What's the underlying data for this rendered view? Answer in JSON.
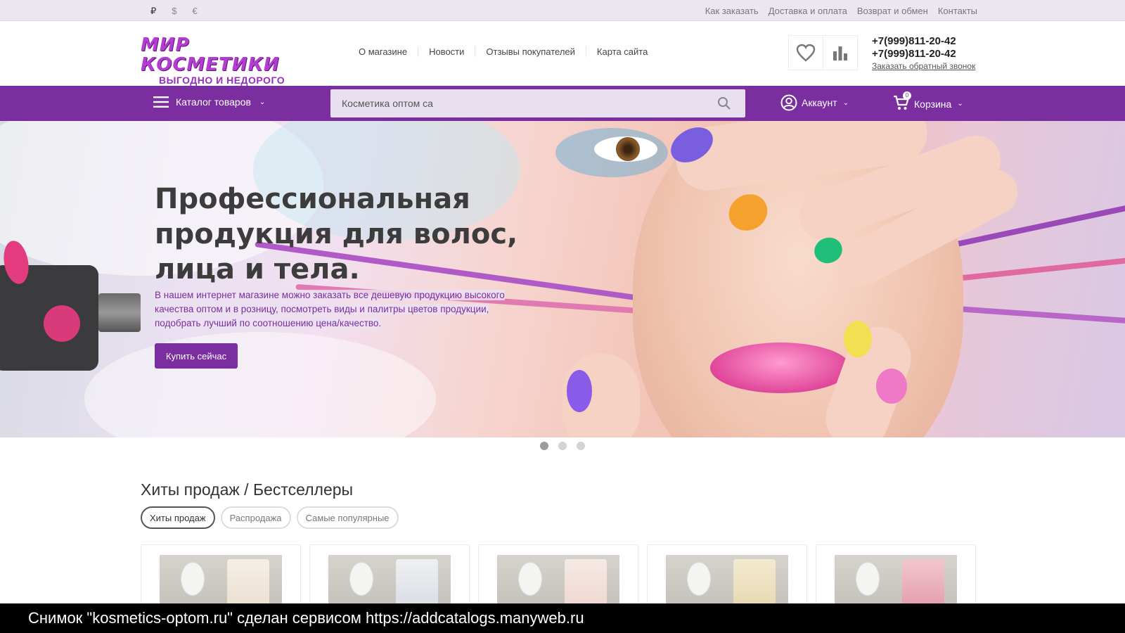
{
  "topbar": {
    "currencies": [
      "₽",
      "$",
      "€"
    ],
    "links": [
      "Как заказать",
      "Доставка и оплата",
      "Возврат и обмен",
      "Контакты"
    ]
  },
  "header": {
    "logo_main": "МИР КОСМЕТИКИ",
    "logo_sub": "ВЫГОДНО И НЕДОРОГО",
    "nav": [
      "О магазине",
      "Новости",
      "Отзывы покупателей",
      "Карта сайта"
    ],
    "phones": [
      "+7(999)811-20-42",
      "+7(999)811-20-42"
    ],
    "callback": "Заказать обратный звонок",
    "icons": [
      "heart-icon",
      "bar-chart-icon"
    ]
  },
  "nav": {
    "catalog": "Каталог товаров",
    "search_value": "Косметика оптом са",
    "account": "Аккаунт",
    "cart": "Корзина",
    "cart_count": "0"
  },
  "banner": {
    "title_lines": [
      "Профессиональная",
      "продукция для волос,",
      "лица и тела."
    ],
    "text_lines": [
      "В нашем интернет магазине можно заказать все дешевую продукцию высокого",
      "качества оптом и в розницу, посмотреть виды и палитры цветов продукции,",
      "подобрать лучший по соотношению цена/качество."
    ],
    "button": "Купить сейчас",
    "slides": 3,
    "active_slide": 1
  },
  "section": {
    "title": "Хиты продаж / Бестселлеры",
    "tabs": [
      "Хиты продаж",
      "Распродажа",
      "Самые популярные"
    ],
    "active_tab": 0
  },
  "caption": "Снимок \"kosmetics-optom.ru\" сделан сервисом https://addcatalogs.manyweb.ru",
  "colors": {
    "brand_purple": "#7a2ea0",
    "topbar_bg": "#ece6f0",
    "search_bg": "#e8e0ee"
  }
}
